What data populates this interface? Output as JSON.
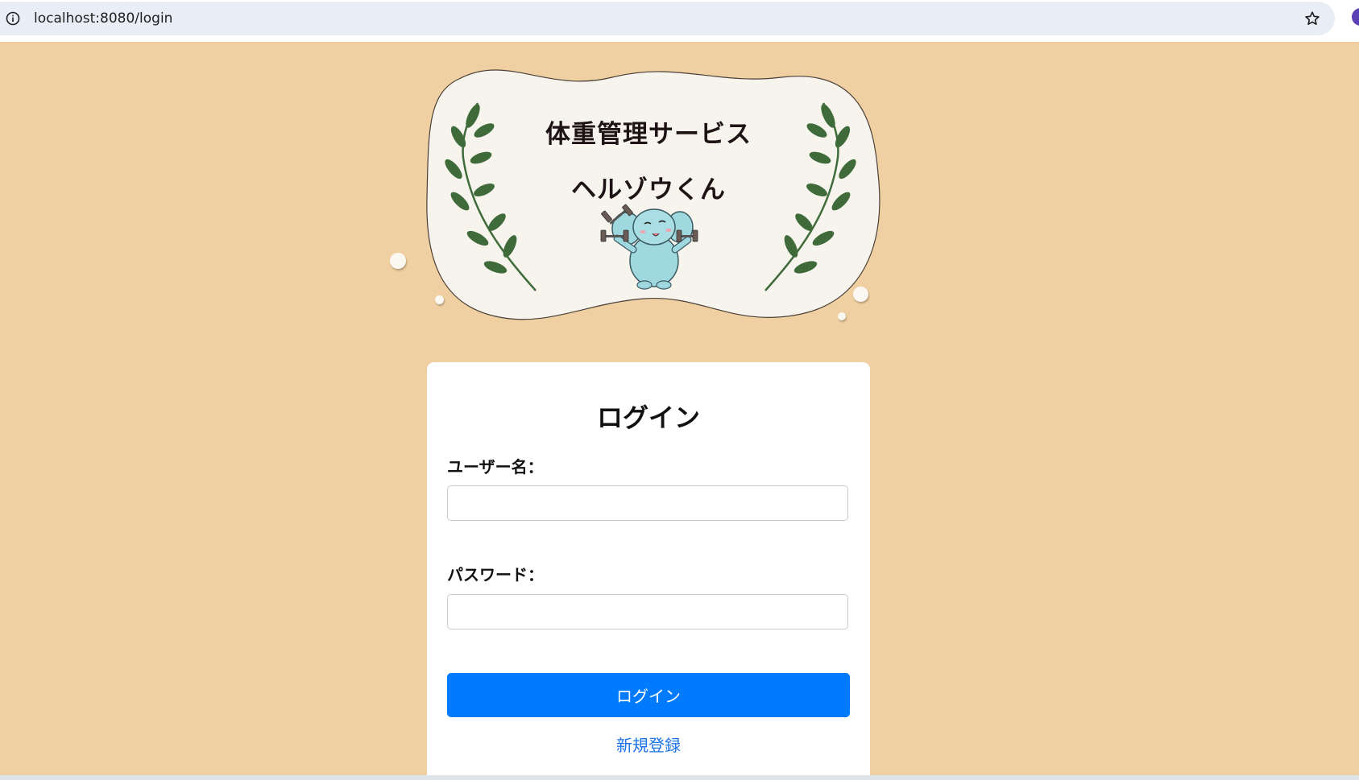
{
  "browser": {
    "url": "localhost:8080/login",
    "info_icon": "info-icon",
    "bookmark_icon": "star-icon"
  },
  "banner": {
    "title": "体重管理サービス",
    "subtitle": "ヘルゾウくん",
    "mascot": "elephant-with-dumbbells-icon",
    "decoration": "laurel-branch-icon"
  },
  "login_form": {
    "heading": "ログイン",
    "username_label": "ユーザー名：",
    "username_value": "",
    "password_label": "パスワード：",
    "password_value": "",
    "submit_label": "ログイン",
    "register_link": "新規登録"
  },
  "colors": {
    "page_background": "#f0d0a2",
    "banner_fill": "#f7f4ee",
    "primary_button": "#007bff",
    "link": "#1a73e8",
    "leaf": "#3f6b3a"
  }
}
